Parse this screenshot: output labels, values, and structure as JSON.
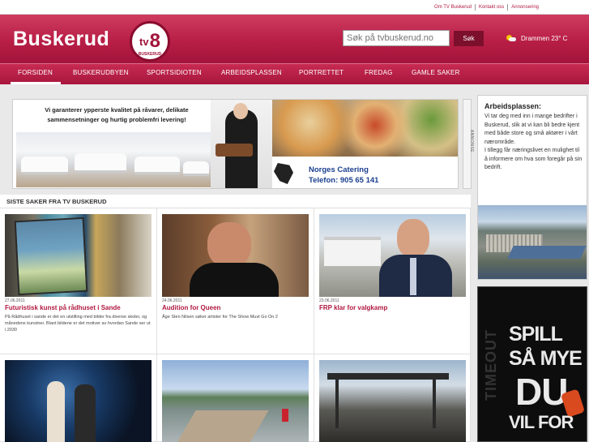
{
  "toplinks": [
    "Om TV Buskerud",
    "Kontakt oss",
    "Annonsering"
  ],
  "header": {
    "logo_text": "Buskerud",
    "tv8_logo": {
      "tv": "tv",
      "eight": "8",
      "sub": "BUSKERUD"
    },
    "search_placeholder": "Søk på tvbuskerud.no",
    "search_button": "Søk",
    "weather": "Drammen 23° C"
  },
  "nav": [
    "FORSIDEN",
    "BUSKERUDBYEN",
    "SPORTSIDIOTEN",
    "ARBEIDSPLASSEN",
    "PORTRETTET",
    "FREDAG",
    "GAMLE SAKER"
  ],
  "ad": {
    "slogan": "Vi garanterer ypperste kvalitet på råvarer, delikate sammensetninger og hurtig problemfri levering!",
    "company": "Norges Catering",
    "phone": "Telefon:  905 65 141",
    "label": "ANNONSE"
  },
  "stories": {
    "heading": "SISTE SAKER FRA TV BUSKERUD",
    "items": [
      {
        "date": "27.06.2011",
        "title": "Futuristisk kunst på rådhuset i Sande",
        "text": "På Rådhuset i sande er det en utstilling med bilder fra diverse skoler, og månedens kunstner. Blant bildene er det motiver av hvordan Sande ser ut i 2030"
      },
      {
        "date": "24.06.2011",
        "title": "Audition for Queen",
        "text": "Åge Sten Nilsen søker artister for The Show Must Go On 2"
      },
      {
        "date": "23.06.2011",
        "title": "FRP klar for valgkamp",
        "text": ""
      },
      {
        "date": "",
        "title": "",
        "text": ""
      },
      {
        "date": "",
        "title": "",
        "text": ""
      },
      {
        "date": "",
        "title": "",
        "text": ""
      }
    ]
  },
  "sidebar": {
    "title": "Arbeidsplassen:",
    "text1": "Vi tar deg med inn i mange bedrifter i Buskerud, slik at vi kan bli bedre kjent med både store og små aktører i vårt nærområde.",
    "text2": "I tillegg får næringslivet en mulighet til å informere om hva som foregår på sin bedrift."
  },
  "side_ad": {
    "lines": [
      "SPILL",
      "SÅ MYE",
      "DU",
      "VIL FOR"
    ],
    "vertical": "TIMEOUT"
  },
  "colors": {
    "brand": "#b81e46",
    "title_red": "#b0183f",
    "ad_blue": "#1b3f8f"
  }
}
